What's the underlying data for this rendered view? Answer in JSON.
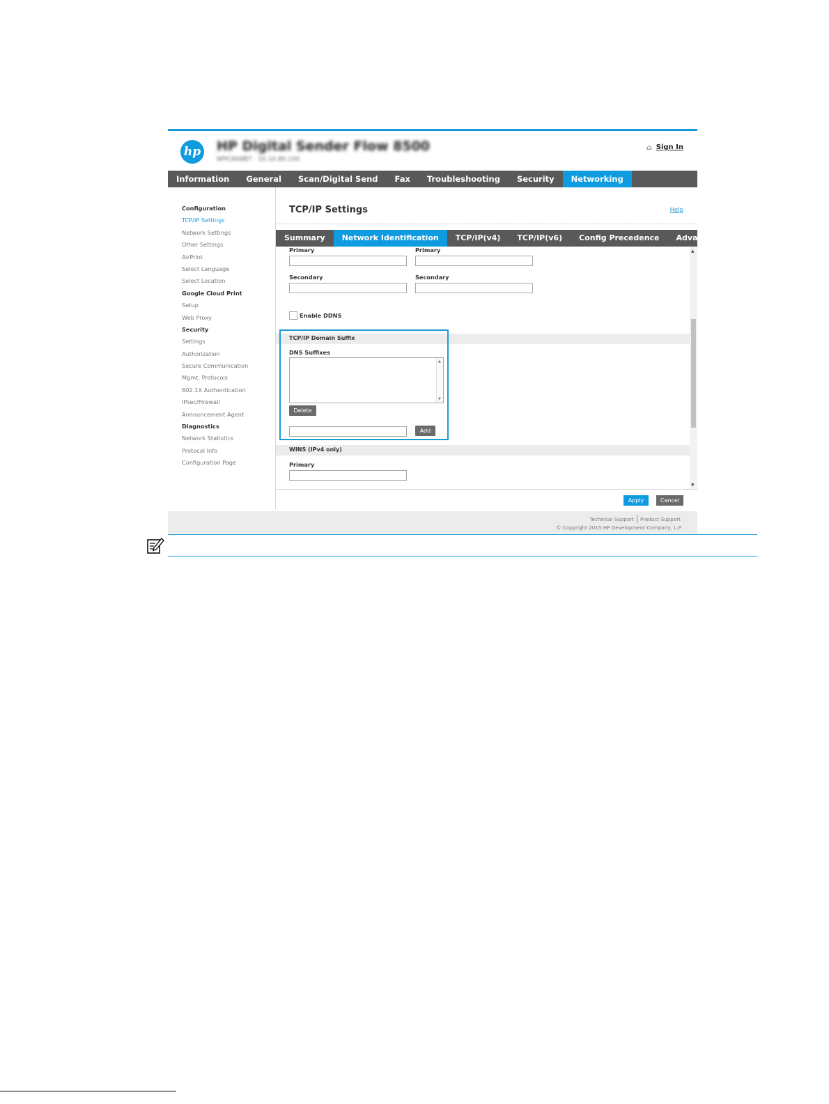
{
  "header": {
    "product_name": "HP Digital Sender Flow 8500",
    "product_sub": "NPIC8A8B7 · 10.10.80.100",
    "sign_in": "Sign In"
  },
  "main_tabs": [
    "Information",
    "General",
    "Scan/Digital Send",
    "Fax",
    "Troubleshooting",
    "Security",
    "Networking"
  ],
  "sidebar": [
    {
      "label": "Configuration",
      "type": "heading"
    },
    {
      "label": "TCP/IP Settings",
      "type": "current"
    },
    {
      "label": "Network Settings",
      "type": "item"
    },
    {
      "label": "Other Settings",
      "type": "item"
    },
    {
      "label": "AirPrint",
      "type": "item"
    },
    {
      "label": "Select Language",
      "type": "item"
    },
    {
      "label": "Select Location",
      "type": "item"
    },
    {
      "label": "Google Cloud Print",
      "type": "heading"
    },
    {
      "label": "Setup",
      "type": "item"
    },
    {
      "label": "Web Proxy",
      "type": "item"
    },
    {
      "label": "Security",
      "type": "heading"
    },
    {
      "label": "Settings",
      "type": "item"
    },
    {
      "label": "Authorization",
      "type": "item"
    },
    {
      "label": "Secure Communication",
      "type": "item"
    },
    {
      "label": "Mgmt. Protocols",
      "type": "item"
    },
    {
      "label": "802.1X Authentication",
      "type": "item"
    },
    {
      "label": "IPsec/Firewall",
      "type": "item"
    },
    {
      "label": "Announcement Agent",
      "type": "item"
    },
    {
      "label": "Diagnostics",
      "type": "heading"
    },
    {
      "label": "Network Statistics",
      "type": "item"
    },
    {
      "label": "Protocol Info",
      "type": "item"
    },
    {
      "label": "Configuration Page",
      "type": "item"
    }
  ],
  "content": {
    "title": "TCP/IP Settings",
    "help": "Help",
    "sub_tabs": [
      "Summary",
      "Network Identification",
      "TCP/IP(v4)",
      "TCP/IP(v6)",
      "Config Precedence",
      "Advanced"
    ],
    "primary_label": "Primary",
    "secondary_label": "Secondary",
    "enable_ddns": "Enable DDNS",
    "domain_suffix_section": "TCP/IP Domain Suffix",
    "dns_suffixes_label": "DNS Suffixes",
    "delete_label": "Delete",
    "add_label": "Add",
    "wins_section": "WINS (IPv4 only)",
    "wins_primary_label": "Primary"
  },
  "actions": {
    "apply": "Apply",
    "cancel": "Cancel"
  },
  "footer": {
    "technical_support": "Technical Support",
    "product_support": "Product Support",
    "copyright": "© Copyright 2015 HP Development Company, L.P."
  },
  "colors": {
    "accent": "#0f9be0",
    "nav_bg": "#595959"
  },
  "icons": [
    "hp-logo",
    "home-icon",
    "note-icon"
  ]
}
